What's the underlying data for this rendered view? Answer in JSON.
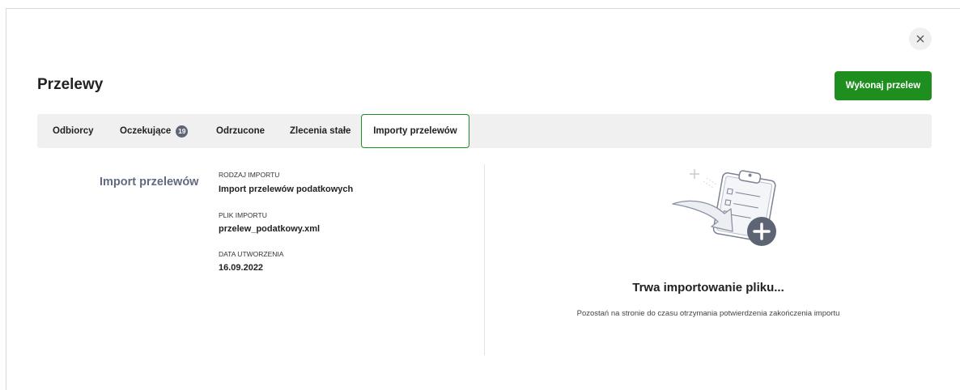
{
  "header": {
    "title": "Przelewy",
    "primary_button": "Wykonaj przelew",
    "close_icon": "close-icon"
  },
  "tabs": [
    {
      "label": "Odbiorcy"
    },
    {
      "label": "Oczekujące",
      "badge": "19"
    },
    {
      "label": "Odrzucone"
    },
    {
      "label": "Zlecenia stałe"
    },
    {
      "label": "Importy przelewów",
      "active": true
    }
  ],
  "import": {
    "section_title": "Import przelewów",
    "fields": [
      {
        "label": "RODZAJ IMPORTU",
        "value": "Import przelewów podatkowych"
      },
      {
        "label": "PLIK IMPORTU",
        "value": "przelew_podatkowy.xml"
      },
      {
        "label": "DATA UTWORZENIA",
        "value": "16.09.2022"
      }
    ]
  },
  "status": {
    "title": "Trwa importowanie pliku...",
    "subtitle": "Pozostań na stronie do czasu otrzymania potwierdzenia zakończenia importu",
    "illustration_icon": "clipboard-add-icon"
  },
  "colors": {
    "accent": "#1e8f1e",
    "badge": "#5d6474",
    "section_title": "#606a80",
    "tab_bar": "#f0f0f0"
  }
}
